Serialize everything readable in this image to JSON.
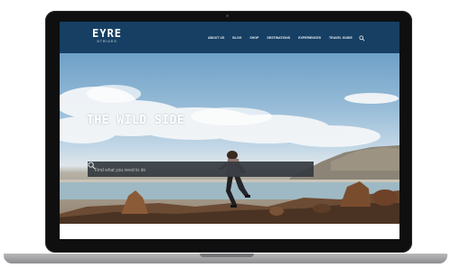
{
  "site": {
    "logo": {
      "main": "EYRE",
      "sub": "STRIDES"
    },
    "nav": [
      {
        "label": "ABOUT US"
      },
      {
        "label": "BLOG"
      },
      {
        "label": "SHOP"
      },
      {
        "label": "DESTINATIONS"
      },
      {
        "label": "EXPERIENCES"
      },
      {
        "label": "TRAVEL GUIDE"
      }
    ],
    "nav_search_icon": "search-icon"
  },
  "hero": {
    "title": "THE WILD SIDE",
    "search_placeholder": "Find what you need to do",
    "search_icon": "search-icon"
  },
  "colors": {
    "header_bg": "#163f63",
    "laptop_bezel": "#0f0f10",
    "search_bg": "#343a40"
  }
}
